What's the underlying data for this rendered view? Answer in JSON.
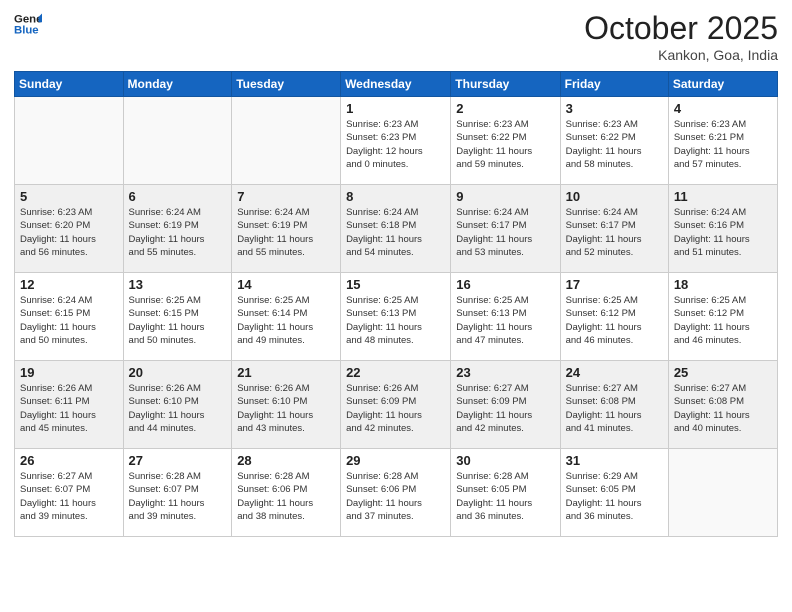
{
  "header": {
    "logo_line1": "General",
    "logo_line2": "Blue",
    "month": "October 2025",
    "location": "Kankon, Goa, India"
  },
  "days_of_week": [
    "Sunday",
    "Monday",
    "Tuesday",
    "Wednesday",
    "Thursday",
    "Friday",
    "Saturday"
  ],
  "weeks": [
    [
      {
        "day": "",
        "info": ""
      },
      {
        "day": "",
        "info": ""
      },
      {
        "day": "",
        "info": ""
      },
      {
        "day": "1",
        "info": "Sunrise: 6:23 AM\nSunset: 6:23 PM\nDaylight: 12 hours\nand 0 minutes."
      },
      {
        "day": "2",
        "info": "Sunrise: 6:23 AM\nSunset: 6:22 PM\nDaylight: 11 hours\nand 59 minutes."
      },
      {
        "day": "3",
        "info": "Sunrise: 6:23 AM\nSunset: 6:22 PM\nDaylight: 11 hours\nand 58 minutes."
      },
      {
        "day": "4",
        "info": "Sunrise: 6:23 AM\nSunset: 6:21 PM\nDaylight: 11 hours\nand 57 minutes."
      }
    ],
    [
      {
        "day": "5",
        "info": "Sunrise: 6:23 AM\nSunset: 6:20 PM\nDaylight: 11 hours\nand 56 minutes."
      },
      {
        "day": "6",
        "info": "Sunrise: 6:24 AM\nSunset: 6:19 PM\nDaylight: 11 hours\nand 55 minutes."
      },
      {
        "day": "7",
        "info": "Sunrise: 6:24 AM\nSunset: 6:19 PM\nDaylight: 11 hours\nand 55 minutes."
      },
      {
        "day": "8",
        "info": "Sunrise: 6:24 AM\nSunset: 6:18 PM\nDaylight: 11 hours\nand 54 minutes."
      },
      {
        "day": "9",
        "info": "Sunrise: 6:24 AM\nSunset: 6:17 PM\nDaylight: 11 hours\nand 53 minutes."
      },
      {
        "day": "10",
        "info": "Sunrise: 6:24 AM\nSunset: 6:17 PM\nDaylight: 11 hours\nand 52 minutes."
      },
      {
        "day": "11",
        "info": "Sunrise: 6:24 AM\nSunset: 6:16 PM\nDaylight: 11 hours\nand 51 minutes."
      }
    ],
    [
      {
        "day": "12",
        "info": "Sunrise: 6:24 AM\nSunset: 6:15 PM\nDaylight: 11 hours\nand 50 minutes."
      },
      {
        "day": "13",
        "info": "Sunrise: 6:25 AM\nSunset: 6:15 PM\nDaylight: 11 hours\nand 50 minutes."
      },
      {
        "day": "14",
        "info": "Sunrise: 6:25 AM\nSunset: 6:14 PM\nDaylight: 11 hours\nand 49 minutes."
      },
      {
        "day": "15",
        "info": "Sunrise: 6:25 AM\nSunset: 6:13 PM\nDaylight: 11 hours\nand 48 minutes."
      },
      {
        "day": "16",
        "info": "Sunrise: 6:25 AM\nSunset: 6:13 PM\nDaylight: 11 hours\nand 47 minutes."
      },
      {
        "day": "17",
        "info": "Sunrise: 6:25 AM\nSunset: 6:12 PM\nDaylight: 11 hours\nand 46 minutes."
      },
      {
        "day": "18",
        "info": "Sunrise: 6:25 AM\nSunset: 6:12 PM\nDaylight: 11 hours\nand 46 minutes."
      }
    ],
    [
      {
        "day": "19",
        "info": "Sunrise: 6:26 AM\nSunset: 6:11 PM\nDaylight: 11 hours\nand 45 minutes."
      },
      {
        "day": "20",
        "info": "Sunrise: 6:26 AM\nSunset: 6:10 PM\nDaylight: 11 hours\nand 44 minutes."
      },
      {
        "day": "21",
        "info": "Sunrise: 6:26 AM\nSunset: 6:10 PM\nDaylight: 11 hours\nand 43 minutes."
      },
      {
        "day": "22",
        "info": "Sunrise: 6:26 AM\nSunset: 6:09 PM\nDaylight: 11 hours\nand 42 minutes."
      },
      {
        "day": "23",
        "info": "Sunrise: 6:27 AM\nSunset: 6:09 PM\nDaylight: 11 hours\nand 42 minutes."
      },
      {
        "day": "24",
        "info": "Sunrise: 6:27 AM\nSunset: 6:08 PM\nDaylight: 11 hours\nand 41 minutes."
      },
      {
        "day": "25",
        "info": "Sunrise: 6:27 AM\nSunset: 6:08 PM\nDaylight: 11 hours\nand 40 minutes."
      }
    ],
    [
      {
        "day": "26",
        "info": "Sunrise: 6:27 AM\nSunset: 6:07 PM\nDaylight: 11 hours\nand 39 minutes."
      },
      {
        "day": "27",
        "info": "Sunrise: 6:28 AM\nSunset: 6:07 PM\nDaylight: 11 hours\nand 39 minutes."
      },
      {
        "day": "28",
        "info": "Sunrise: 6:28 AM\nSunset: 6:06 PM\nDaylight: 11 hours\nand 38 minutes."
      },
      {
        "day": "29",
        "info": "Sunrise: 6:28 AM\nSunset: 6:06 PM\nDaylight: 11 hours\nand 37 minutes."
      },
      {
        "day": "30",
        "info": "Sunrise: 6:28 AM\nSunset: 6:05 PM\nDaylight: 11 hours\nand 36 minutes."
      },
      {
        "day": "31",
        "info": "Sunrise: 6:29 AM\nSunset: 6:05 PM\nDaylight: 11 hours\nand 36 minutes."
      },
      {
        "day": "",
        "info": ""
      }
    ]
  ]
}
